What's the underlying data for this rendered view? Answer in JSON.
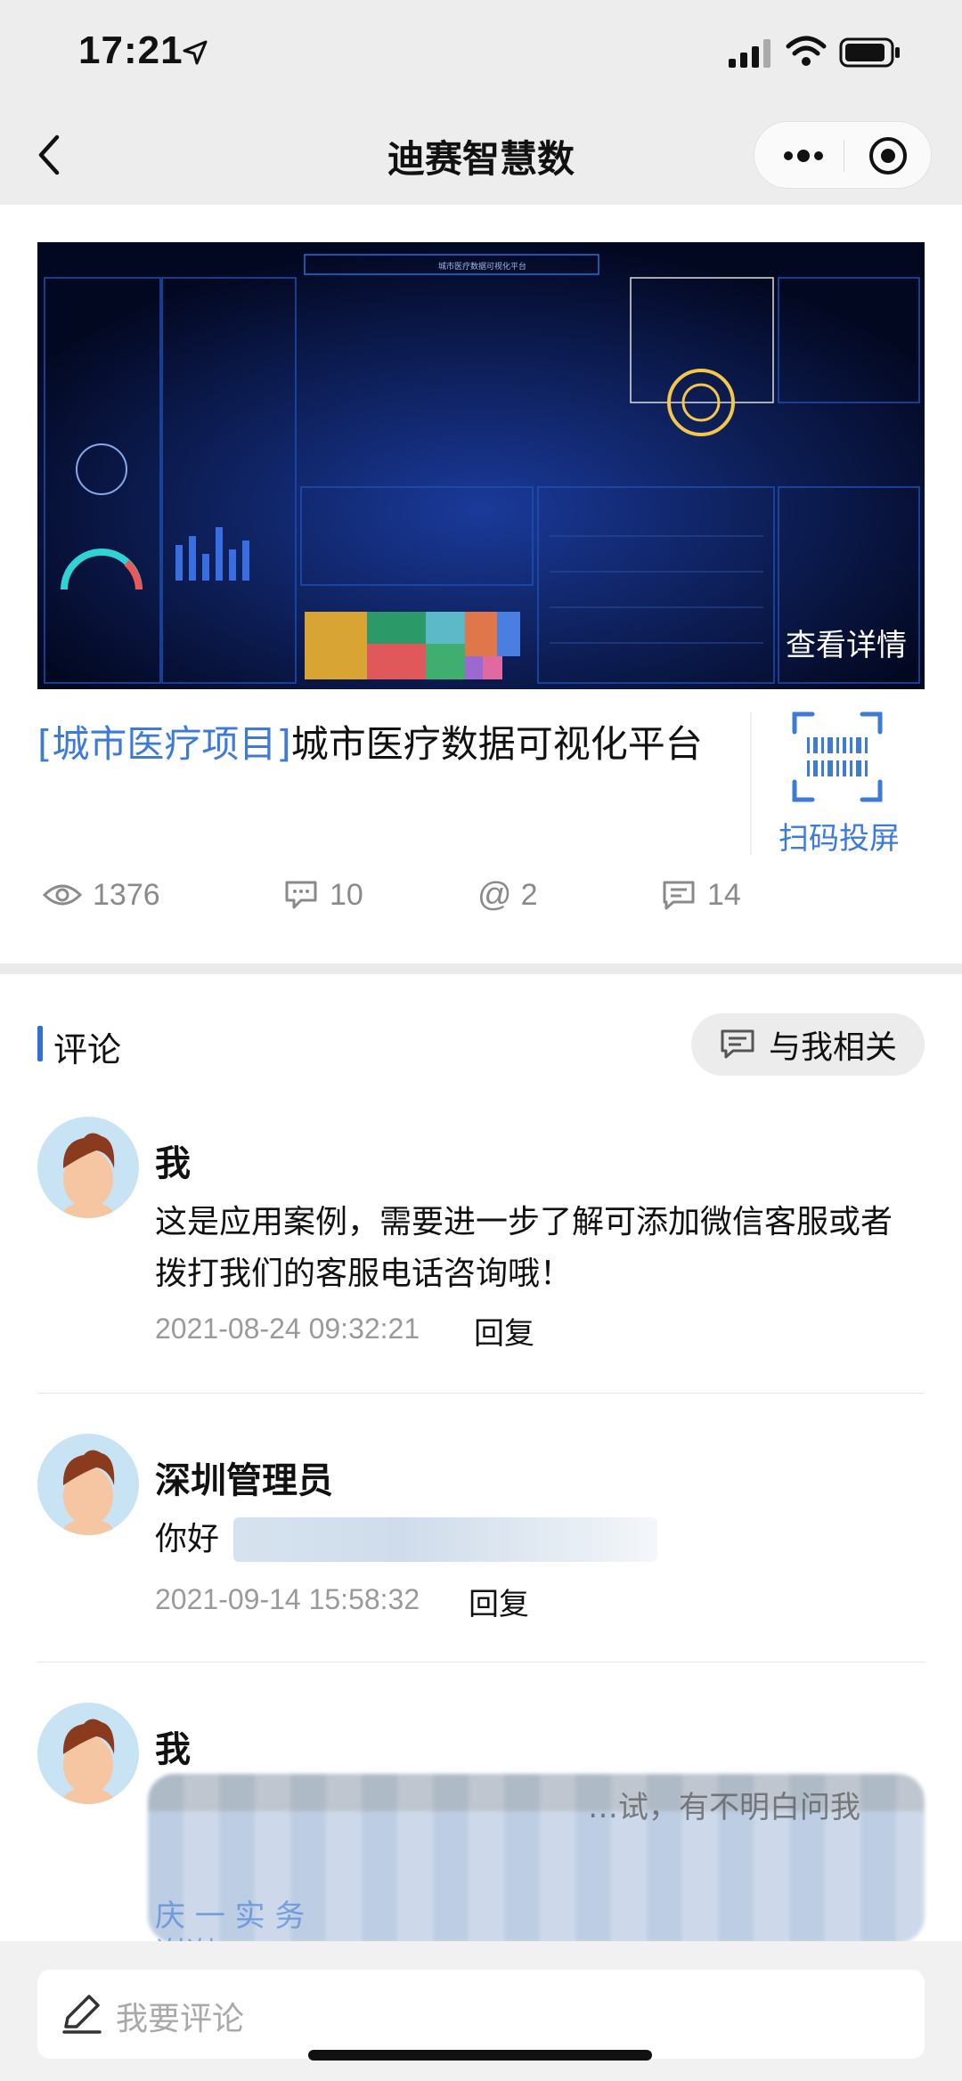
{
  "status_bar": {
    "time": "17:21"
  },
  "nav": {
    "title": "迪赛智慧数"
  },
  "project": {
    "tag": "[城市医疗项目]",
    "title": "城市医疗数据可视化平台",
    "cover_detail": "查看详情",
    "qr_label": "扫码投屏",
    "stats": {
      "views": "1376",
      "comments": "10",
      "mentions": "2",
      "messages": "14"
    }
  },
  "comments": {
    "title": "评论",
    "filter_label": "与我相关",
    "items": [
      {
        "author": "我",
        "text": "这是应用案例，需要进一步了解可添加微信客服或者拨打我们的客服电话咨询哦！",
        "time": "2021-08-24 09:32:21",
        "reply": "回复"
      },
      {
        "author": "深圳管理员",
        "text": "你好",
        "time": "2021-09-14 15:58:32",
        "reply": "回复"
      },
      {
        "author": "我",
        "text_partial": "…试，有不明白问我",
        "text_partial2": "庆 一 实 务",
        "text_partial3": "谢谢"
      }
    ]
  },
  "input": {
    "placeholder": "我要评论"
  }
}
